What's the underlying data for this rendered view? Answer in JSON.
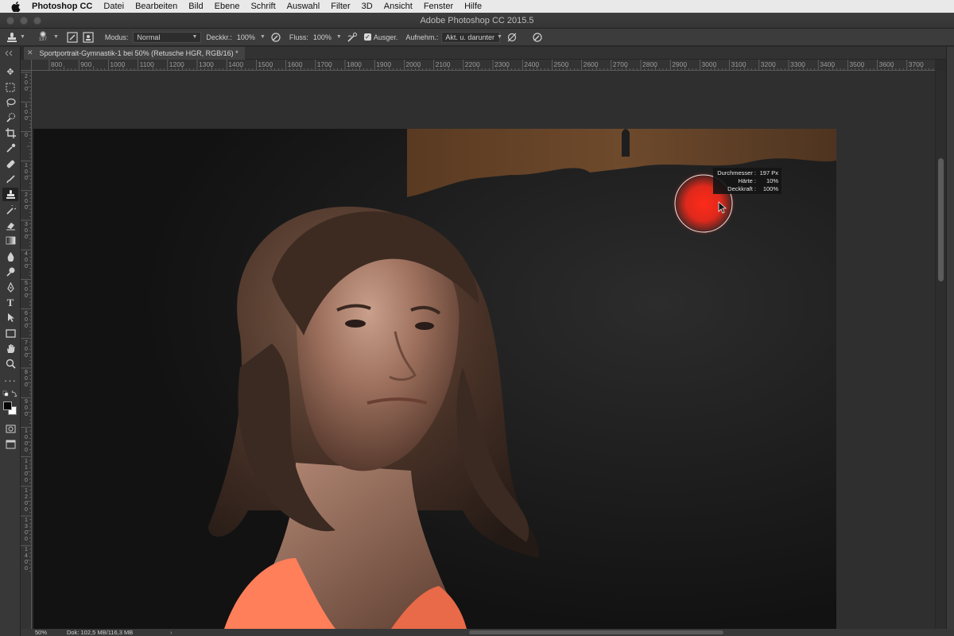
{
  "menubar": {
    "app_name": "Photoshop CC",
    "items": [
      "Datei",
      "Bearbeiten",
      "Bild",
      "Ebene",
      "Schrift",
      "Auswahl",
      "Filter",
      "3D",
      "Ansicht",
      "Fenster",
      "Hilfe"
    ]
  },
  "window": {
    "title": "Adobe Photoshop CC 2015.5"
  },
  "options": {
    "brush_size": "197",
    "mode_label": "Modus:",
    "mode_value": "Normal",
    "opacity_label": "Deckkr.:",
    "opacity_value": "100%",
    "flow_label": "Fluss:",
    "flow_value": "100%",
    "aligned_label": "Ausger.",
    "sample_label": "Aufnehm.:",
    "sample_value": "Akt. u. darunter"
  },
  "document": {
    "tab_title": "Sportportrait-Gymnastik-1 bei 50% (Retusche HGR, RGB/16) *"
  },
  "ruler_top": [
    "800",
    "900",
    "1000",
    "1100",
    "1200",
    "1300",
    "1400",
    "1500",
    "1600",
    "1700",
    "1800",
    "1900",
    "2000",
    "2100",
    "2200",
    "2300",
    "2400",
    "2500",
    "2600",
    "2700",
    "2800",
    "2900",
    "3000",
    "3100",
    "3200",
    "3300",
    "3400",
    "3500",
    "3600",
    "3700"
  ],
  "ruler_left": [
    "200",
    "100",
    "0",
    "100",
    "200",
    "300",
    "400",
    "500",
    "600",
    "700",
    "800",
    "900",
    "1000",
    "1100",
    "1200",
    "1300",
    "1400"
  ],
  "brush_hud": {
    "diameter_label": "Durchmesser :",
    "diameter_value": "197 Px",
    "hardness_label": "Härte :",
    "hardness_value": "10%",
    "opacity_label": "Deckkraft :",
    "opacity_value": "100%"
  },
  "status": {
    "zoom": "50%",
    "doc_size": "Dok: 102,5 MB/116,3 MB",
    "arrow": "›"
  },
  "colors": {
    "foreground": "#050505",
    "background": "#ffffff",
    "brush_preview": "#ff2a1a"
  },
  "tools": [
    "move-tool",
    "marquee-tool",
    "lasso-tool",
    "quick-selection-tool",
    "crop-tool",
    "eyedropper-tool",
    "healing-brush-tool",
    "brush-tool",
    "clone-stamp-tool",
    "history-brush-tool",
    "eraser-tool",
    "gradient-tool",
    "blur-tool",
    "dodge-tool",
    "pen-tool",
    "type-tool",
    "path-selection-tool",
    "rectangle-tool",
    "hand-tool",
    "zoom-tool",
    "more-tools"
  ]
}
